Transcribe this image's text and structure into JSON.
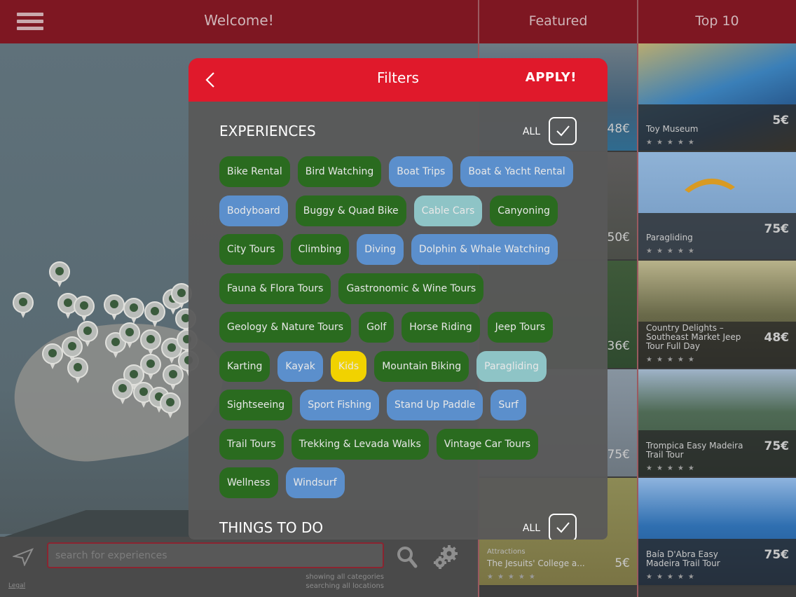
{
  "header": {
    "welcome": "Welcome!",
    "menu_icon": "hamburger-menu-icon"
  },
  "columns": {
    "featured": "Featured",
    "top10": "Top 10"
  },
  "search": {
    "placeholder": "search for experiences",
    "status_line1": "showing all categories",
    "status_line2": "searching all locations",
    "legal": "Legal"
  },
  "featured_prices": [
    "48€",
    "50€",
    "36€",
    "75€",
    "5€"
  ],
  "featured_bottom": {
    "category": "Attractions",
    "title": "The Jesuits' College a..."
  },
  "top10": [
    {
      "title": "Toy Museum",
      "price": "5€"
    },
    {
      "title": "Paragliding",
      "price": "75€"
    },
    {
      "title": "Country Delights – Southeast Market Jeep Tour Full Day",
      "price": "48€"
    },
    {
      "title": "Trompica Easy Madeira Trail Tour",
      "price": "75€"
    },
    {
      "title": "Baía D'Abra Easy Madeira Trail Tour",
      "price": "75€"
    }
  ],
  "stars": "★★★★★",
  "filters": {
    "title": "Filters",
    "apply": "APPLY!",
    "experiences_title": "EXPERIENCES",
    "things_title": "THINGS TO DO",
    "all_label": "ALL",
    "tag_rows": [
      [
        {
          "label": "Bike Rental",
          "style": "green"
        },
        {
          "label": "Bird Watching",
          "style": "green"
        },
        {
          "label": "Boat Trips",
          "style": "blue"
        },
        {
          "label": "Boat & Yacht Rental",
          "style": "blue"
        }
      ],
      [
        {
          "label": "Bodyboard",
          "style": "blue"
        },
        {
          "label": "Buggy & Quad Bike",
          "style": "green"
        },
        {
          "label": "Cable Cars",
          "style": "light"
        },
        {
          "label": "Canyoning",
          "style": "green"
        }
      ],
      [
        {
          "label": "City Tours",
          "style": "green"
        },
        {
          "label": "Climbing",
          "style": "green"
        },
        {
          "label": "Diving",
          "style": "blue"
        },
        {
          "label": "Dolphin & Whale Watching",
          "style": "blue"
        }
      ],
      [
        {
          "label": "Fauna & Flora Tours",
          "style": "green"
        },
        {
          "label": "Gastronomic & Wine Tours",
          "style": "green"
        }
      ],
      [
        {
          "label": "Geology & Nature Tours",
          "style": "green"
        },
        {
          "label": "Golf",
          "style": "green"
        },
        {
          "label": "Horse Riding",
          "style": "green"
        },
        {
          "label": "Jeep Tours",
          "style": "green"
        }
      ],
      [
        {
          "label": "Karting",
          "style": "green"
        },
        {
          "label": "Kayak",
          "style": "blue"
        },
        {
          "label": "Kids",
          "style": "yellow"
        },
        {
          "label": "Mountain Biking",
          "style": "green"
        },
        {
          "label": "Paragliding",
          "style": "light"
        }
      ],
      [
        {
          "label": "Sightseeing",
          "style": "green"
        },
        {
          "label": "Sport Fishing",
          "style": "blue"
        },
        {
          "label": "Stand Up Paddle",
          "style": "blue"
        },
        {
          "label": "Surf",
          "style": "blue"
        }
      ],
      [
        {
          "label": "Trail Tours",
          "style": "green"
        },
        {
          "label": "Trekking & Levada Walks",
          "style": "green"
        },
        {
          "label": "Vintage Car Tours",
          "style": "green"
        }
      ],
      [
        {
          "label": "Wellness",
          "style": "green"
        },
        {
          "label": "Windsurf",
          "style": "blue"
        }
      ]
    ]
  },
  "colors": {
    "header_red": "#7e1722",
    "modal_red": "#e0192b",
    "tag_green": "#2a6b1f",
    "tag_blue": "#5b8fcc",
    "tag_light": "#8ec4c6",
    "tag_yellow": "#f1d200"
  }
}
